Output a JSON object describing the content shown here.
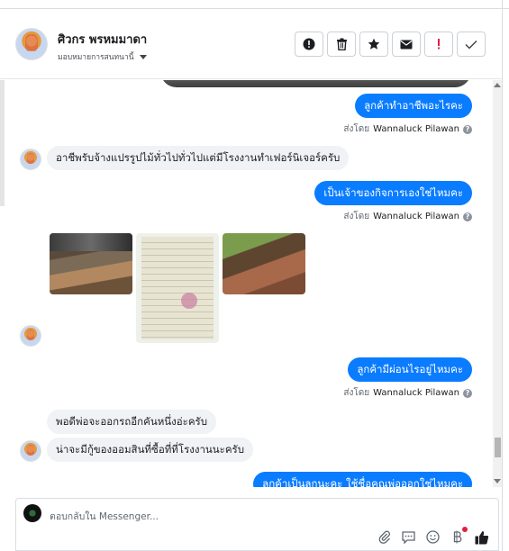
{
  "header": {
    "contact_name": "ศิวกร พรหมมาดา",
    "assign_label": "มอบหมายการสนทนานี้",
    "actions": [
      {
        "name": "follow-up-button",
        "icon": "exclamation-circle-icon"
      },
      {
        "name": "delete-button",
        "icon": "trash-icon"
      },
      {
        "name": "star-button",
        "icon": "star-icon"
      },
      {
        "name": "mark-unread-button",
        "icon": "envelope-icon"
      },
      {
        "name": "mark-spam-button",
        "icon": "red-exclamation-icon"
      },
      {
        "name": "mark-done-button",
        "icon": "check-icon"
      }
    ]
  },
  "messages": {
    "m1": {
      "text": "ลูกค้าทำอาชีพอะไรคะ",
      "direction": "outgoing"
    },
    "m1_sentby_prefix": "ส่งโดย",
    "m1_sentby_name": "Wannaluck Pilawan",
    "m2": {
      "text": "อาชีพรับจ้างแปรรูปไม้ทั่วไปทั่วไปแต่มีโรงงานทำเฟอร์นิเจอร์ครับ",
      "direction": "incoming"
    },
    "m3": {
      "text": "เป็นเจ้าของกิจการเองใช่ไหมคะ",
      "direction": "outgoing"
    },
    "m3_sentby_prefix": "ส่งโดย",
    "m3_sentby_name": "Wannaluck Pilawan",
    "m4": {
      "text": "ลูกค้ามีผ่อนไรอยู่ไหมคะ",
      "direction": "outgoing"
    },
    "m4_sentby_prefix": "ส่งโดย",
    "m4_sentby_name": "Wannaluck Pilawan",
    "m5": {
      "text": "พอดีพ่อจะออกรถอีกคันหนึ่งอ่ะครับ",
      "direction": "incoming"
    },
    "m6": {
      "text": "น่าจะมีกู้ของออมสินที่ซื้อที่ที่โรงงานนะครับ",
      "direction": "incoming"
    },
    "m7": {
      "text": "ลูกค้าเป็นลูกนะคะ ใช้ชื่อคุณพ่อออกใช่ไหมคะ",
      "direction": "outgoing"
    }
  },
  "composer": {
    "placeholder": "ตอบกลับใน Messenger..."
  },
  "colors": {
    "outgoing_bubble": "#0a7cff",
    "incoming_bubble": "#f0f2f5",
    "spam_icon": "#e41e3f"
  }
}
